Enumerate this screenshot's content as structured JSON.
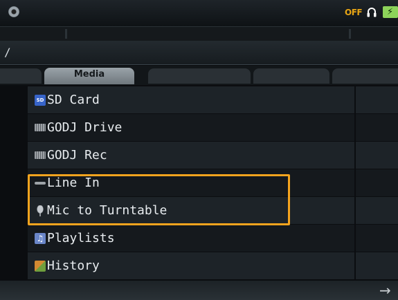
{
  "status": {
    "headphone_mode": "OFF",
    "headphone_icon": "headphones-icon",
    "battery_icon": "battery-charging-icon",
    "disc_icon": "disc-icon"
  },
  "path": {
    "value": "/"
  },
  "tabs": [
    {
      "label": "",
      "active": false
    },
    {
      "label": "Media",
      "active": true
    },
    {
      "label": "",
      "active": false
    },
    {
      "label": "",
      "active": false
    },
    {
      "label": "",
      "active": false
    }
  ],
  "media_items": [
    {
      "label": "SD Card",
      "icon": "sd-card-icon",
      "icon_text": "SD"
    },
    {
      "label": "GODJ Drive",
      "icon": "drive-icon"
    },
    {
      "label": "GODJ Rec",
      "icon": "drive-icon"
    },
    {
      "label": "Line In",
      "icon": "line-in-icon"
    },
    {
      "label": "Mic to Turntable",
      "icon": "microphone-icon"
    },
    {
      "label": "Playlists",
      "icon": "playlist-icon",
      "icon_text": "♫"
    },
    {
      "label": "History",
      "icon": "history-icon"
    }
  ],
  "bottom": {
    "next_glyph": "→"
  },
  "colors": {
    "highlight": "#f5a41e",
    "status_off": "#e8a514",
    "battery": "#8dd35a"
  }
}
